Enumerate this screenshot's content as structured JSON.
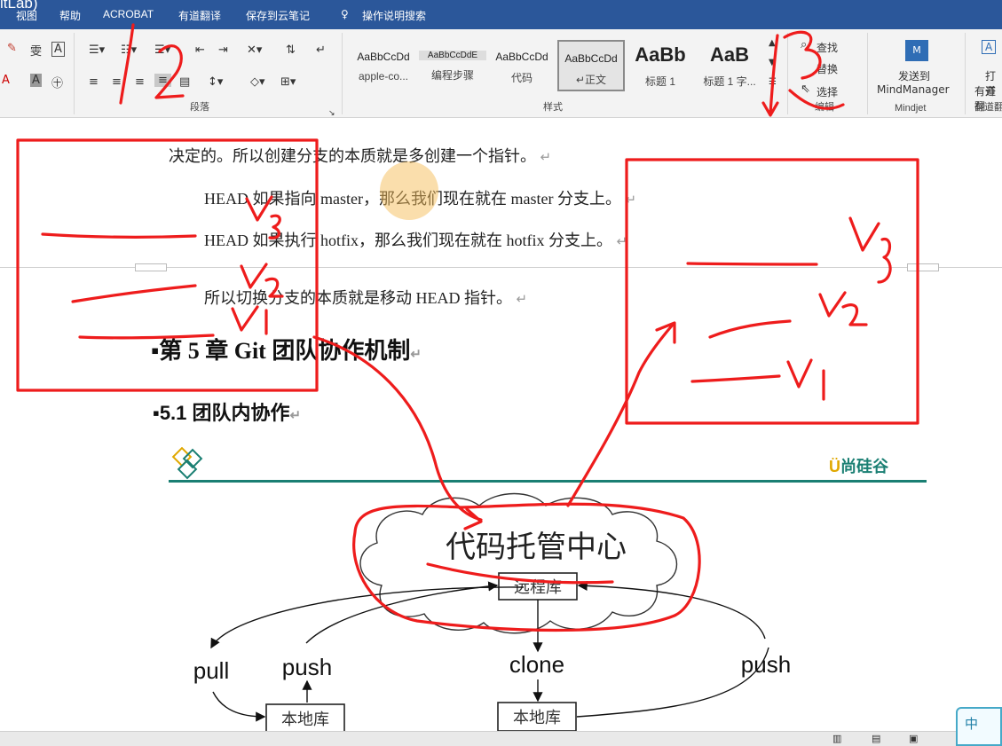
{
  "menubar": {
    "corner": "itLab)",
    "items": [
      "视图",
      "帮助",
      "ACROBAT",
      "有道翻译",
      "保存到云笔记",
      "操作说明搜索"
    ]
  },
  "ribbon": {
    "groups": {
      "paragraph": "段落",
      "styles": "样式",
      "edit": "编辑",
      "mindjet": "Mindjet",
      "youdao": "有道翻"
    },
    "styles": [
      {
        "sample": "AaBbCcDd",
        "name": "apple-co..."
      },
      {
        "sample": "AaBbCcDdE",
        "name": "编程步骤"
      },
      {
        "sample": "AaBbCcDd",
        "name": "代码"
      },
      {
        "sample": "AaBbCcDd",
        "name": "↵正文"
      },
      {
        "sample": "AaBb",
        "name": "标题 1"
      },
      {
        "sample": "AaB",
        "name": "标题 1 字..."
      }
    ],
    "find": "查找",
    "replace": "替换",
    "select": "选择",
    "mindmanager_line1": "发送到",
    "mindmanager_line2": "MindManager",
    "youdao_open": "打开",
    "youdao_sub": "有道翻"
  },
  "document": {
    "line1": "决定的。所以创建分支的本质就是多创建一个指针。",
    "line2": "HEAD 如果指向 master，那么我们现在就在 master 分支上。",
    "line3": "HEAD 如果执行 hotfix，那么我们现在就在 hotfix 分支上。",
    "line4": "所以切换分支的本质就是移动 HEAD 指针。",
    "heading_chapter": "第 5 章 Git 团队协作机制",
    "heading_section": "5.1  团队内协作",
    "brand": "尚硅谷",
    "return_mark": "↵"
  },
  "diagram": {
    "cloud_title": "代码托管中心",
    "remote_repo": "远程库",
    "pull": "pull",
    "push_left": "push",
    "clone": "clone",
    "push_right": "push",
    "local_repo_left": "本地库",
    "local_repo_right": "本地库"
  },
  "annotations": {
    "v3": "V3",
    "v2": "V2",
    "v1": "V1",
    "n1": "1",
    "n2": "2",
    "n3": "3"
  },
  "ime": {
    "label": "中"
  },
  "colors": {
    "menubar": "#2b579a",
    "annotation": "#ee1c1c",
    "teal": "#1a7f73"
  }
}
